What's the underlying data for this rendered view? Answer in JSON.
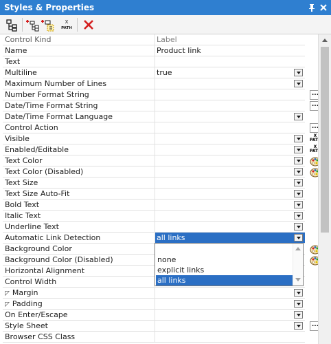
{
  "window": {
    "title": "Styles & Properties",
    "pin_icon": "pin-icon",
    "close_icon": "close-icon"
  },
  "toolbar": {
    "buttons": [
      {
        "name": "tree-view-button",
        "icon": "tree-structure-icon"
      },
      {
        "name": "add-style-button",
        "icon": "add-style-icon"
      },
      {
        "name": "add-style-group-button",
        "icon": "add-style-group-icon"
      },
      {
        "name": "xpath-button",
        "icon": "xpath-icon",
        "label_top": "X",
        "label_bottom": "PATH"
      },
      {
        "name": "delete-button",
        "icon": "red-x-icon"
      }
    ]
  },
  "properties": [
    {
      "name": "Control Kind",
      "value": "Label",
      "value_dim": true,
      "name_dim": true
    },
    {
      "name": "Name",
      "value": "Product link"
    },
    {
      "name": "Text",
      "value": ""
    },
    {
      "name": "Multiline",
      "value": "true",
      "dropdown": true
    },
    {
      "name": "Maximum Number of Lines",
      "value": "",
      "dropdown": true
    },
    {
      "name": "Number Format String",
      "value": "",
      "side": "ellipsis"
    },
    {
      "name": "Date/Time Format String",
      "value": "",
      "side": "ellipsis"
    },
    {
      "name": "Date/Time Format Language",
      "value": "",
      "dropdown": true
    },
    {
      "name": "Control Action",
      "value": "",
      "side": "ellipsis"
    },
    {
      "name": "Visible",
      "value": "",
      "dropdown": true,
      "side": "xpath"
    },
    {
      "name": "Enabled/Editable",
      "value": "",
      "dropdown": true,
      "side": "xpath"
    },
    {
      "name": "Text Color",
      "value": "",
      "dropdown": true,
      "side": "color"
    },
    {
      "name": "Text Color (Disabled)",
      "value": "",
      "dropdown": true,
      "side": "color"
    },
    {
      "name": "Text Size",
      "value": "",
      "dropdown": true
    },
    {
      "name": "Text Size Auto-Fit",
      "value": "",
      "dropdown": true
    },
    {
      "name": "Bold Text",
      "value": "",
      "dropdown": true
    },
    {
      "name": "Italic Text",
      "value": "",
      "dropdown": true
    },
    {
      "name": "Underline Text",
      "value": "",
      "dropdown": true
    },
    {
      "name": "Automatic Link Detection",
      "value": "all links",
      "dropdown": true,
      "selected": true
    },
    {
      "name": "Background Color",
      "value": "",
      "side": "color"
    },
    {
      "name": "Background Color (Disabled)",
      "value": "",
      "side": "color"
    },
    {
      "name": "Horizontal Alignment",
      "value": ""
    },
    {
      "name": "Control Width",
      "value": ""
    },
    {
      "name": "Margin",
      "value": "",
      "dropdown": true,
      "expandable": true
    },
    {
      "name": "Padding",
      "value": "",
      "dropdown": true,
      "expandable": true
    },
    {
      "name": "On Enter/Escape",
      "value": "",
      "dropdown": true
    },
    {
      "name": "Style Sheet",
      "value": "",
      "dropdown": true,
      "side": "ellipsis"
    },
    {
      "name": "Browser CSS Class",
      "value": ""
    }
  ],
  "dropdown_popup": {
    "options": [
      "none",
      "explicit links",
      "all links"
    ],
    "selected": "all links"
  },
  "side_labels": {
    "ellipsis": "...",
    "xpath_top": "X",
    "xpath_bottom": "PATH"
  },
  "colors": {
    "titlebar": "#2f7fd0",
    "selection": "#2b6fc4",
    "delete_red": "#d42020"
  }
}
